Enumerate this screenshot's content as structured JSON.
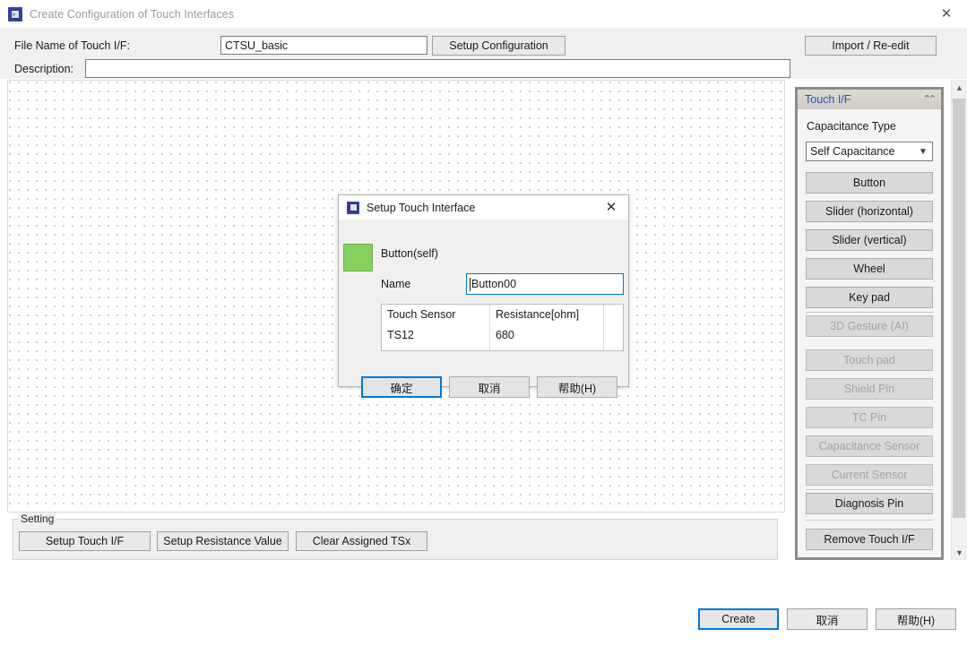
{
  "window": {
    "title": "Create Configuration of Touch Interfaces",
    "app_icon": "chip-icon",
    "close_icon": "close-icon"
  },
  "form": {
    "file_name_label": "File Name of Touch I/F:",
    "file_name_value": "CTSU_basic",
    "description_label": "Description:",
    "description_value": "",
    "description_placeholder": "",
    "setup_configuration_label": "Setup Configuration",
    "import_reedit_label": "Import / Re-edit"
  },
  "setting_group": {
    "legend": "Setting",
    "buttons": [
      {
        "label": "Setup Touch I/F"
      },
      {
        "label": "Setup Resistance Value"
      },
      {
        "label": "Clear Assigned TSx"
      }
    ]
  },
  "palette": {
    "header_title": "Touch I/F",
    "collapse_icon": "chevron-up-icon",
    "capacitance_type_label": "Capacitance Type",
    "capacitance_type_value": "Self Capacitance",
    "capacitance_type_arrow": "chevron-down-icon",
    "items": [
      {
        "label": "Button",
        "enabled": true
      },
      {
        "label": "Slider (horizontal)",
        "enabled": true
      },
      {
        "label": "Slider (vertical)",
        "enabled": true
      },
      {
        "label": "Wheel",
        "enabled": true
      },
      {
        "label": "Key pad",
        "enabled": true
      },
      {
        "label": "3D Gesture (AI)",
        "enabled": false
      },
      {
        "label": "Touch pad",
        "enabled": false
      },
      {
        "label": "Shield Pin",
        "enabled": false
      },
      {
        "label": "TC Pin",
        "enabled": false
      },
      {
        "label": "Capacitance Sensor",
        "enabled": false
      },
      {
        "label": "Current Sensor",
        "enabled": false
      },
      {
        "label": "Diagnosis Pin",
        "enabled": true
      }
    ],
    "remove_label": "Remove Touch I/F"
  },
  "scrollbar": {
    "up_icon": "chevron-up-icon",
    "down_icon": "chevron-down-icon"
  },
  "footer": {
    "create_label": "Create",
    "cancel_label": "取消",
    "help_label": "帮助(H)"
  },
  "dialog": {
    "title": "Setup Touch Interface",
    "icon": "chip-icon",
    "close_icon": "close-icon",
    "swatch_color": "#86d060",
    "interface_type": "Button(self)",
    "name_label": "Name",
    "name_value": "Button00",
    "table": {
      "headers": [
        "Touch Sensor",
        "Resistance[ohm]"
      ],
      "rows": [
        [
          "TS12",
          "680"
        ]
      ]
    },
    "ok_label": "确定",
    "cancel_label": "取消",
    "help_label": "帮助(H)"
  },
  "colors": {
    "accent": "#0078d7",
    "panel_header_text": "#2050c8",
    "swatch_green": "#86d060",
    "window_bg": "#f0f0f0"
  }
}
